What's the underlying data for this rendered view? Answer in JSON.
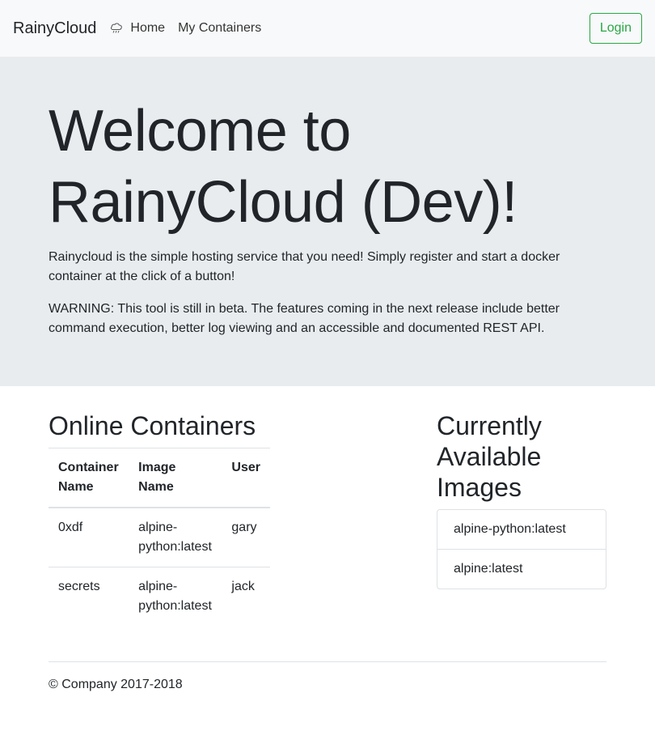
{
  "navbar": {
    "brand": "RainyCloud",
    "home_label": "Home",
    "containers_label": "My Containers",
    "login_label": "Login"
  },
  "hero": {
    "title_line1": "Welcome to",
    "title_line2": "RainyCloud (Dev)!",
    "intro": "Rainycloud is the simple hosting service that you need! Simply register and start a docker container at the click of a button!",
    "warning": "WARNING: This tool is still in beta. The features coming in the next release include better command execution, better log viewing and an accessible and documented REST API."
  },
  "containers": {
    "heading": "Online Containers",
    "columns": [
      "Container Name",
      "Image Name",
      "User"
    ],
    "rows": [
      [
        "0xdf",
        "alpine-python:latest",
        "gary"
      ],
      [
        "secrets",
        "alpine-python:latest",
        "jack"
      ]
    ]
  },
  "images": {
    "heading": "Currently Available Images",
    "items": [
      "alpine-python:latest",
      "alpine:latest"
    ]
  },
  "footer": {
    "copyright": "© Company 2017-2018"
  },
  "colors": {
    "accent": "#28a745",
    "nav_bg": "#f8f9fa",
    "hero_bg": "#e9ecef"
  },
  "icons": {
    "home": "cloud-rain-icon"
  }
}
